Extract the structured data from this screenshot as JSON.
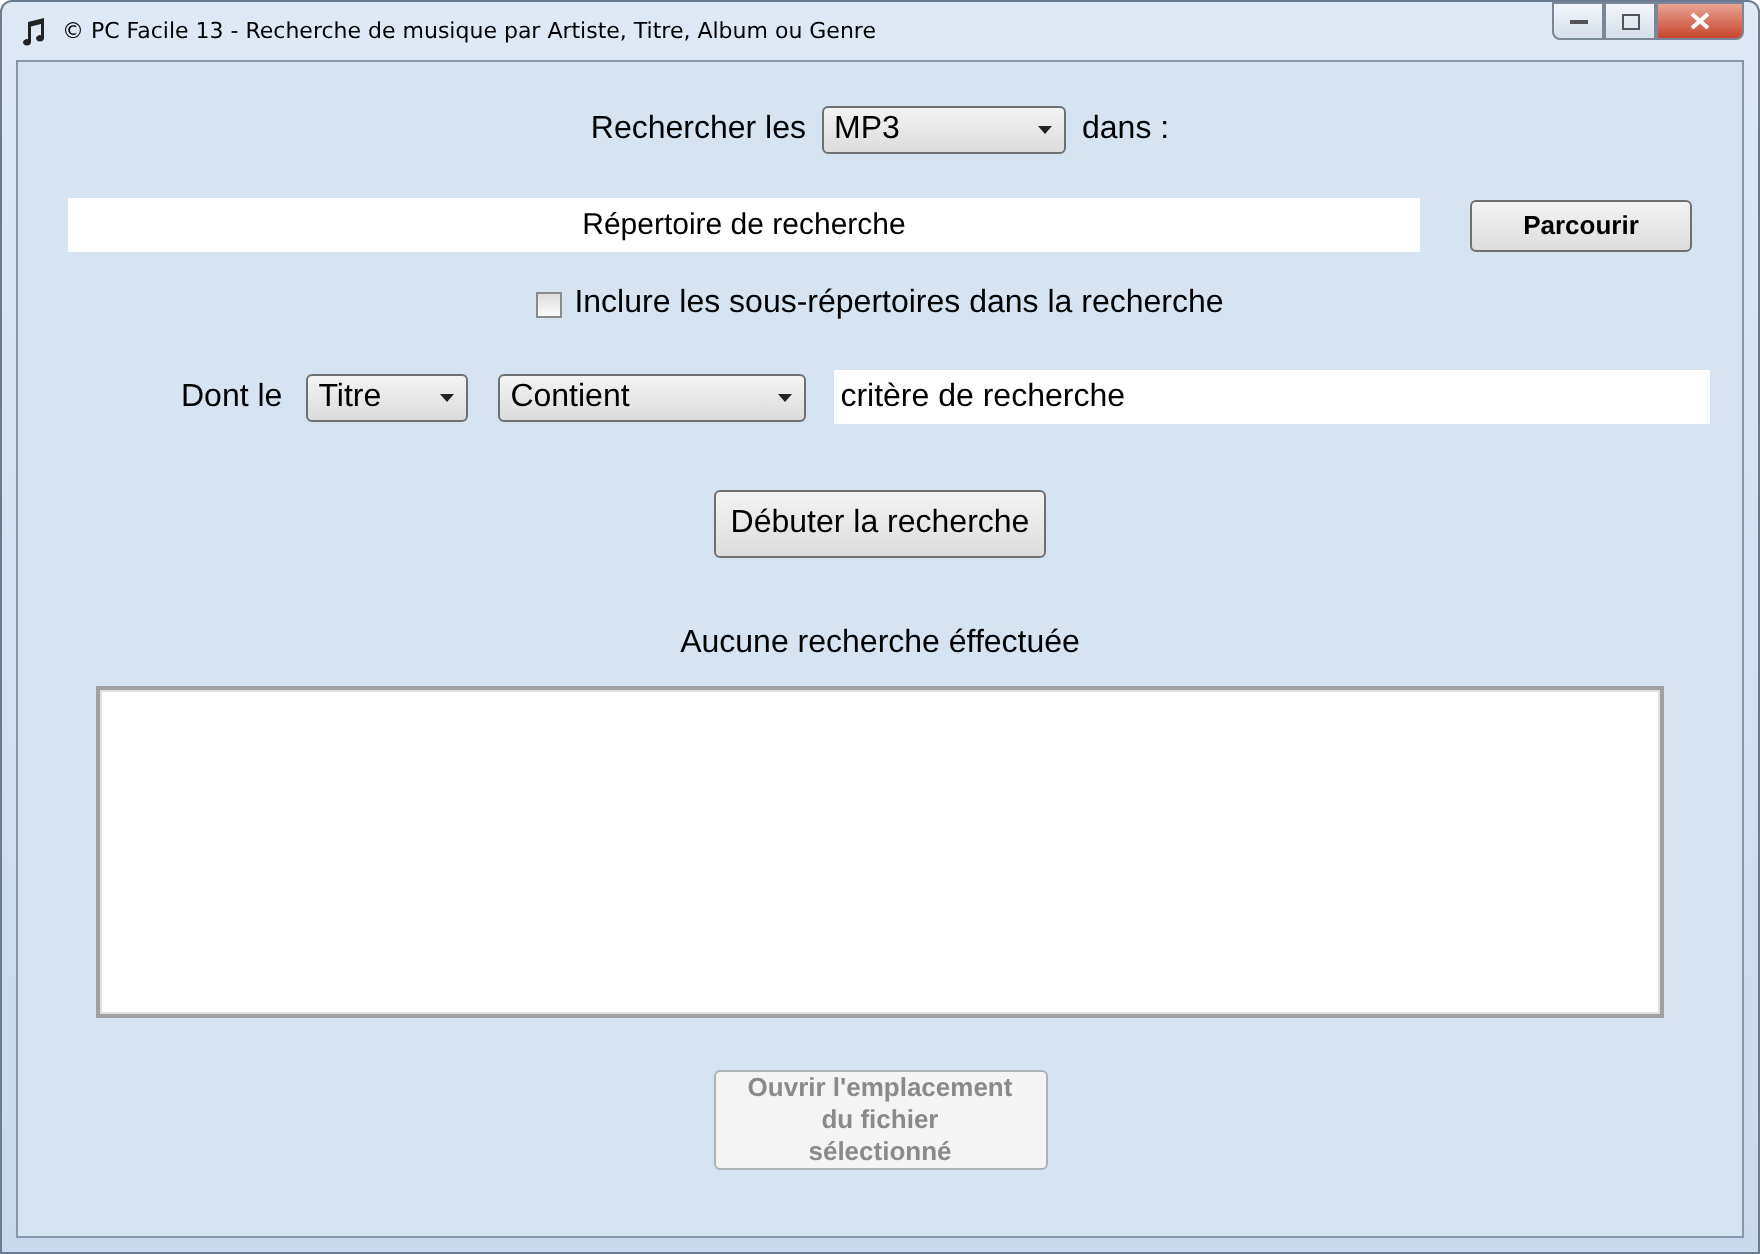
{
  "window": {
    "title": "© PC Facile 13 - Recherche de musique par Artiste, Titre, Album ou Genre"
  },
  "search_type": {
    "label_before": "Rechercher les",
    "value": "MP3",
    "label_after": "dans :"
  },
  "directory": {
    "value": "Répertoire de recherche",
    "browse_button": "Parcourir"
  },
  "include_subfolders": {
    "label": "Inclure les sous-répertoires dans la recherche",
    "checked": false
  },
  "filter": {
    "label": "Dont le",
    "field": "Titre",
    "operator": "Contient",
    "value": "critère de recherche"
  },
  "start_button": "Débuter la recherche",
  "status": "Aucune recherche éffectuée",
  "open_location_button": {
    "label": "Ouvrir l'emplacement du fichier sélectionné",
    "disabled": true
  }
}
